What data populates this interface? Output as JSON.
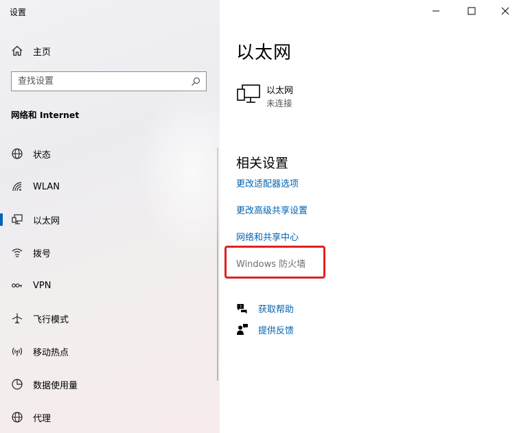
{
  "window": {
    "title": "设置"
  },
  "sidebar": {
    "home_label": "主页",
    "search_placeholder": "查找设置",
    "section_title": "网络和 Internet",
    "items": [
      {
        "label": "状态",
        "icon": "status-globe-icon"
      },
      {
        "label": "WLAN",
        "icon": "wlan-icon"
      },
      {
        "label": "以太网",
        "icon": "ethernet-icon",
        "selected": true
      },
      {
        "label": "拨号",
        "icon": "dialup-icon"
      },
      {
        "label": "VPN",
        "icon": "vpn-icon"
      },
      {
        "label": "飞行模式",
        "icon": "airplane-icon"
      },
      {
        "label": "移动热点",
        "icon": "hotspot-icon"
      },
      {
        "label": "数据使用量",
        "icon": "data-usage-icon"
      },
      {
        "label": "代理",
        "icon": "proxy-globe-icon"
      }
    ]
  },
  "main": {
    "title": "以太网",
    "adapter": {
      "name": "以太网",
      "status": "未连接"
    },
    "related_title": "相关设置",
    "links": [
      {
        "label": "更改适配器选项"
      },
      {
        "label": "更改高级共享设置"
      },
      {
        "label": "网络和共享中心"
      },
      {
        "label": "Windows 防火墙"
      }
    ],
    "help": [
      {
        "label": "获取帮助",
        "icon": "help-chat-icon"
      },
      {
        "label": "提供反馈",
        "icon": "feedback-icon"
      }
    ]
  },
  "colors": {
    "accent": "#0063b1",
    "highlight": "#e02020"
  }
}
